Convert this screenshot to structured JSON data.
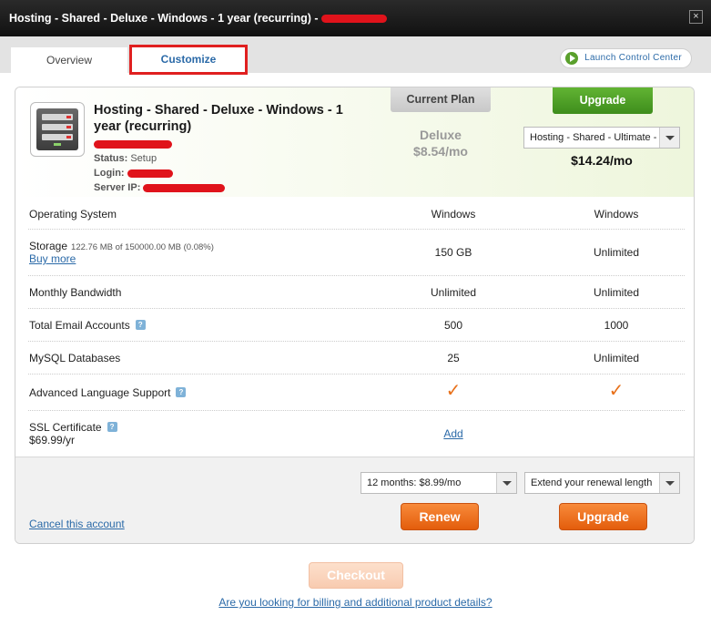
{
  "window": {
    "title": "Hosting - Shared - Deluxe - Windows - 1 year (recurring) -",
    "close_label": "×"
  },
  "tabs": [
    {
      "label": "Overview"
    },
    {
      "label": "Customize"
    }
  ],
  "launch_control_center": "Launch Control Center",
  "plan": {
    "title": "Hosting - Shared - Deluxe - Windows - 1 year (recurring)",
    "status_label": "Status:",
    "status_value": "Setup",
    "login_label": "Login:",
    "server_ip_label": "Server IP:"
  },
  "current_plan": {
    "button_label": "Current Plan",
    "name": "Deluxe",
    "price": "$8.54/mo"
  },
  "upgrade_plan": {
    "button_label": "Upgrade",
    "selected_option": "Hosting - Shared - Ultimate -",
    "price": "$14.24/mo"
  },
  "features": [
    {
      "name": "Operating System",
      "current": "Windows",
      "upgrade": "Windows"
    },
    {
      "name": "Storage",
      "detail": "122.76 MB of 150000.00 MB (0.08%)",
      "link": "Buy more",
      "current": "150 GB",
      "upgrade": "Unlimited"
    },
    {
      "name": "Monthly Bandwidth",
      "current": "Unlimited",
      "upgrade": "Unlimited"
    },
    {
      "name": "Total Email Accounts",
      "current": "500",
      "upgrade": "1000"
    },
    {
      "name": "MySQL Databases",
      "current": "25",
      "upgrade": "Unlimited"
    },
    {
      "name": "Advanced Language Support",
      "current": "✓",
      "upgrade": "✓"
    },
    {
      "name": "SSL Certificate",
      "price": "$69.99/yr",
      "current": "Add",
      "upgrade": ""
    }
  ],
  "footer": {
    "renew_option": "12 months: $8.99/mo",
    "extend_option": "Extend your renewal length",
    "renew_label": "Renew",
    "upgrade_label": "Upgrade",
    "cancel_link": "Cancel this account"
  },
  "checkout_label": "Checkout",
  "billing_link": "Are you looking for billing and additional product details?",
  "colors": {
    "accent_link": "#2b6aa8",
    "upgrade_green": "#4a9a24",
    "action_orange": "#e8701a",
    "redaction_red": "#e0131b"
  },
  "icons": {
    "server": "server-icon",
    "help": "help-icon",
    "check": "checkmark-icon",
    "play": "play-icon",
    "close": "close-icon"
  }
}
